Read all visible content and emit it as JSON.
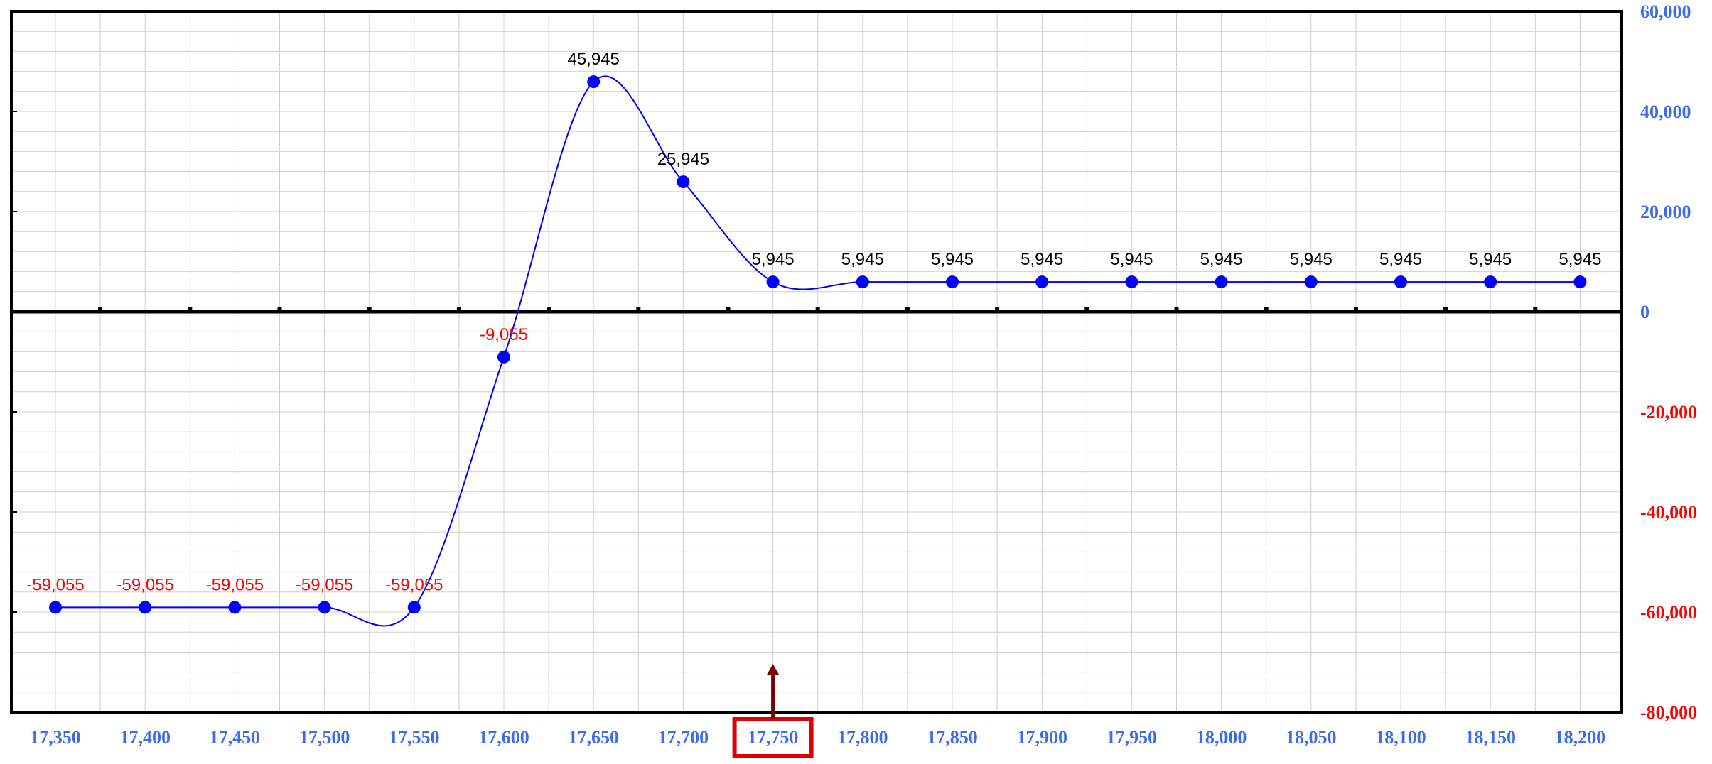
{
  "chart_data": {
    "type": "line",
    "x": [
      17350,
      17400,
      17450,
      17500,
      17550,
      17600,
      17650,
      17700,
      17750,
      17800,
      17850,
      17900,
      17950,
      18000,
      18050,
      18100,
      18150,
      18200
    ],
    "x_tick_labels": [
      "17,350",
      "17,400",
      "17,450",
      "17,500",
      "17,550",
      "17,600",
      "17,650",
      "17,700",
      "17,750",
      "17,800",
      "17,850",
      "17,900",
      "17,950",
      "18,000",
      "18,050",
      "18,100",
      "18,150",
      "18,200"
    ],
    "series": [
      {
        "values": [
          -59055,
          -59055,
          -59055,
          -59055,
          -59055,
          -9055,
          45945,
          25945,
          5945,
          5945,
          5945,
          5945,
          5945,
          5945,
          5945,
          5945,
          5945,
          5945
        ],
        "data_labels": [
          "-59,055",
          "-59,055",
          "-59,055",
          "-59,055",
          "-59,055",
          "-9,055",
          "45,945",
          "25,945",
          "5,945",
          "5,945",
          "5,945",
          "5,945",
          "5,945",
          "5,945",
          "5,945",
          "5,945",
          "5,945",
          "5,945"
        ],
        "smooth": true,
        "markers": "circle"
      }
    ],
    "ylim": [
      -80000,
      60000
    ],
    "y_ticks": [
      -80000,
      -60000,
      -40000,
      -20000,
      0,
      20000,
      40000,
      60000
    ],
    "y_tick_labels": [
      "-80,000",
      "-60,000",
      "-40,000",
      "-20,000",
      "0",
      "20,000",
      "40,000",
      "60,000"
    ],
    "y_axis_position": "right",
    "grid": true,
    "highlighted_x": 17750,
    "highlighted_x_label": "17,750",
    "title": "",
    "xlabel": "",
    "ylabel": ""
  },
  "colors": {
    "line": "#0000ff",
    "marker": "#0000ff",
    "positive_label": "#000000",
    "negative_label": "#ff0000",
    "axis_positive_tick": "#3b6cf0",
    "axis_negative_tick": "#ff0000",
    "x_tick": "#3b6cf0",
    "grid": "#d0d0d0",
    "frame": "#000000",
    "highlight_box": "#e00000",
    "marker_arrow": "#7a0000"
  }
}
